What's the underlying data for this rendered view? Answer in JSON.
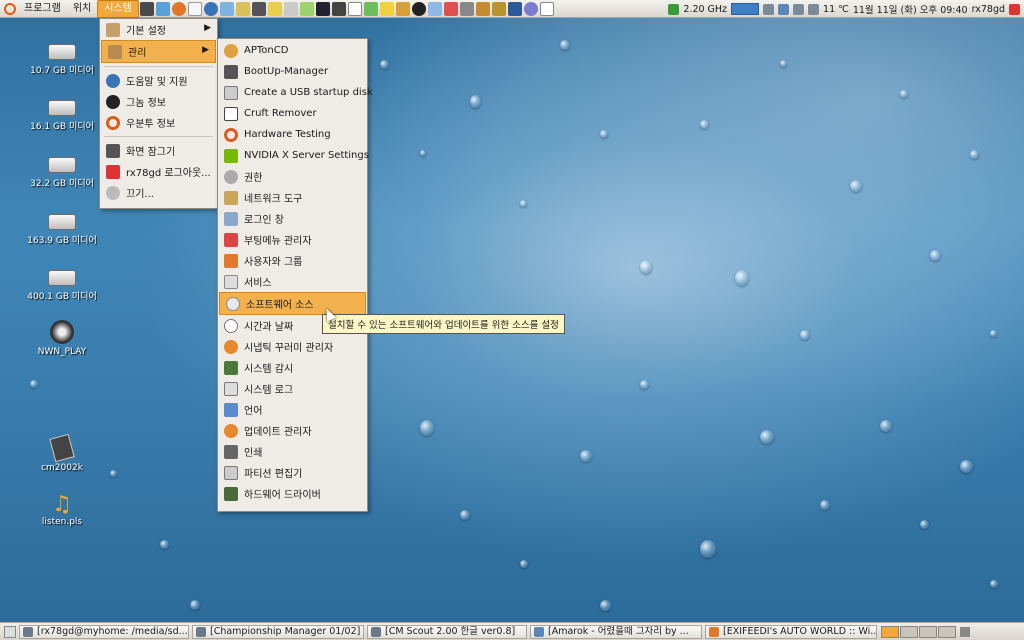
{
  "top_panel": {
    "menus": [
      "프로그램",
      "위치",
      "시스템"
    ],
    "cpu_freq": "2.20 GHz",
    "temperature": "11 ℃",
    "datetime": "11월 11일 (화) 오후 09:40",
    "username": "rx78gd"
  },
  "desktop": {
    "icons": [
      "10.7 GB 미디어",
      "16.1 GB 미디어",
      "32.2 GB 미디어",
      "163.9 GB 미디어",
      "400.1 GB 미디어",
      "NWN_PLAY",
      "cm2002k",
      "listen.pls"
    ]
  },
  "system_menu": {
    "items": [
      "기본 설정",
      "관리",
      "도움말 및 지원",
      "그놈 정보",
      "우분투 정보",
      "화면 잠그기",
      "rx78gd 로그아웃...",
      "끄기..."
    ]
  },
  "admin_menu": {
    "items": [
      "APTonCD",
      "BootUp-Manager",
      "Create a USB startup disk",
      "Cruft Remover",
      "Hardware Testing",
      "NVIDIA X Server Settings",
      "권한",
      "네트워크 도구",
      "로그인 창",
      "부팅메뉴 관리자",
      "사용자와 그룹",
      "서비스",
      "소프트웨어 소스",
      "시간과 날짜",
      "시냅틱 꾸러미 관리자",
      "시스템 감시",
      "시스템 로그",
      "언어",
      "업데이트 관리자",
      "인쇄",
      "파티션 편집기",
      "하드웨어 드라이버"
    ]
  },
  "tooltip": "설치할 수 있는 소프트웨어와 업데이트를 위한 소스를 설정",
  "taskbar": {
    "tasks": [
      "[rx78gd@myhome: /media/sd...",
      "[Championship Manager 01/02]",
      "[CM Scout 2.00 한글 ver0.8]",
      "[Amarok - 어렸을때 그자리 by ...",
      "[EXIFEEDI's AUTO WORLD :: Wi..."
    ]
  },
  "colors": {
    "highlight": "#f3b14d",
    "active_menu": "#f2a83a",
    "tooltip_bg": "#fbf6c4"
  }
}
